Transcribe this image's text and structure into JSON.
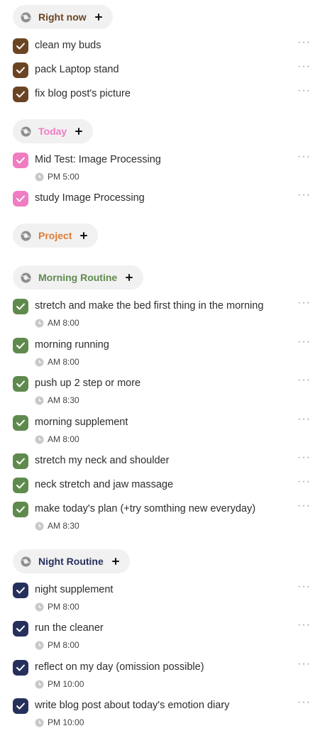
{
  "colors": {
    "brown": "#6b4423",
    "pink": "#f07cc2",
    "orange": "#e07a33",
    "green": "#5f8a4d",
    "navy": "#26305c",
    "chip_bg": "#f1f1f1",
    "more_gray": "#9a9a9a"
  },
  "icons": {
    "section": "globe-icon",
    "add": "plus-icon",
    "done": "check-icon",
    "time": "clock-icon",
    "menu": "more-horizontal-icon"
  },
  "more_label": "···",
  "groups": [
    {
      "name": "Right now",
      "color": "#6b4423",
      "tasks": [
        {
          "title": "clean my buds"
        },
        {
          "title": "pack Laptop stand"
        },
        {
          "title": "fix blog post's picture"
        }
      ]
    },
    {
      "name": "Today",
      "color": "#f07cc2",
      "tasks": [
        {
          "title": "Mid Test: Image Processing",
          "time": "PM 5:00"
        },
        {
          "title": "study Image Processing"
        }
      ]
    },
    {
      "name": "Project",
      "color": "#e07a33",
      "tasks": []
    },
    {
      "name": "Morning Routine",
      "color": "#5f8a4d",
      "tasks": [
        {
          "title": "stretch and make the bed first thing in the morning",
          "time": "AM 8:00"
        },
        {
          "title": "morning running",
          "time": "AM 8:00"
        },
        {
          "title": "push up 2 step or more",
          "time": "AM 8:30"
        },
        {
          "title": "morning supplement",
          "time": "AM 8:00"
        },
        {
          "title": "stretch my neck and shoulder"
        },
        {
          "title": "neck stretch and jaw massage"
        },
        {
          "title": "make today's plan (+try somthing new everyday)",
          "time": "AM 8:30"
        }
      ]
    },
    {
      "name": "Night Routine",
      "color": "#26305c",
      "tasks": [
        {
          "title": "night supplement",
          "time": "PM 8:00"
        },
        {
          "title": "run the cleaner",
          "time": "PM 8:00"
        },
        {
          "title": "reflect on my day (omission possible)",
          "time": "PM 10:00"
        },
        {
          "title": "write blog post about today's emotion diary",
          "time": "PM 10:00"
        }
      ]
    }
  ]
}
